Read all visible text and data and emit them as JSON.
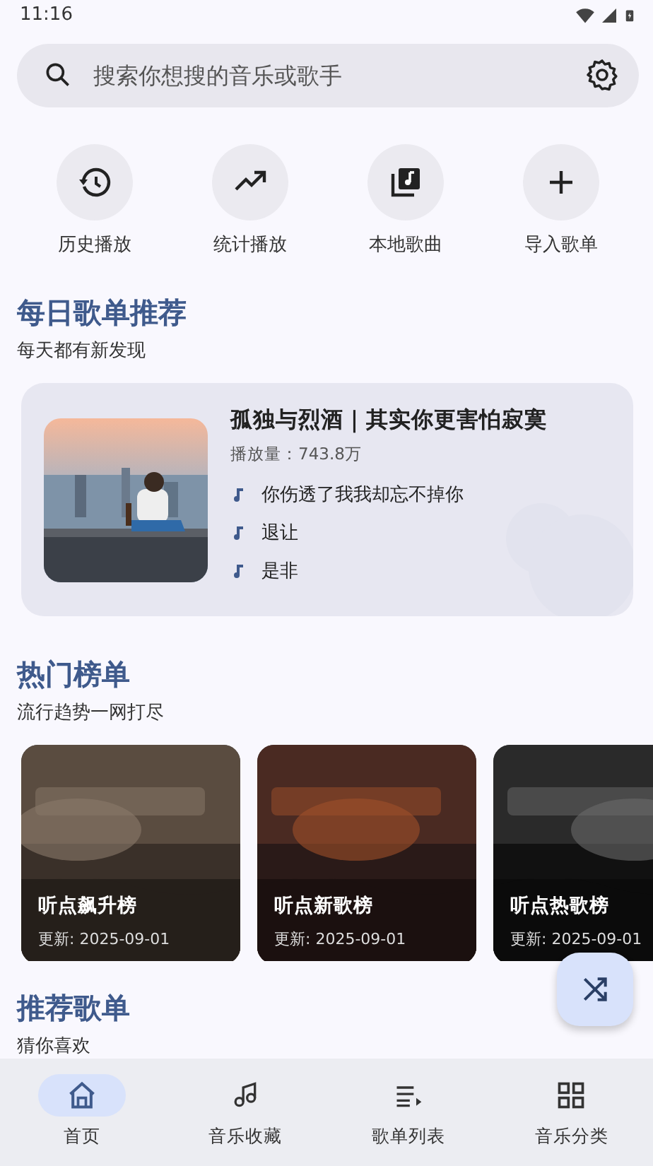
{
  "status_bar": {
    "time": "11:16"
  },
  "search": {
    "placeholder": "搜索你想搜的音乐或歌手"
  },
  "shortcuts": [
    {
      "kind": "history",
      "label": "历史播放"
    },
    {
      "kind": "trend",
      "label": "统计播放"
    },
    {
      "kind": "library",
      "label": "本地歌曲"
    },
    {
      "kind": "add",
      "label": "导入歌单"
    }
  ],
  "daily": {
    "title": "每日歌单推荐",
    "subtitle": "每天都有新发现",
    "playlist": {
      "title": "孤独与烈酒｜其实你更害怕寂寞",
      "plays": "播放量：743.8万",
      "songs": [
        "你伤透了我我却忘不掉你",
        "退让",
        "是非"
      ]
    }
  },
  "charts_section": {
    "title": "热门榜单",
    "subtitle": "流行趋势一网打尽",
    "boards": [
      {
        "kind": "picture",
        "title": "听点飙升榜",
        "updated": "更新: 2025-09-01"
      },
      {
        "kind": "picture",
        "title": "听点新歌榜",
        "updated": "更新: 2025-09-01"
      },
      {
        "kind": "picture",
        "title": "听点热歌榜",
        "updated": "更新: 2025-09-01"
      }
    ]
  },
  "recommend": {
    "title": "推荐歌单",
    "subtitle": "猜你喜欢"
  },
  "nav": [
    {
      "kind": "home",
      "label": "首页",
      "selected": true
    },
    {
      "kind": "music",
      "label": "音乐收藏",
      "selected": false
    },
    {
      "kind": "list",
      "label": "歌单列表",
      "selected": false
    },
    {
      "kind": "grid",
      "label": "音乐分类",
      "selected": false
    }
  ]
}
